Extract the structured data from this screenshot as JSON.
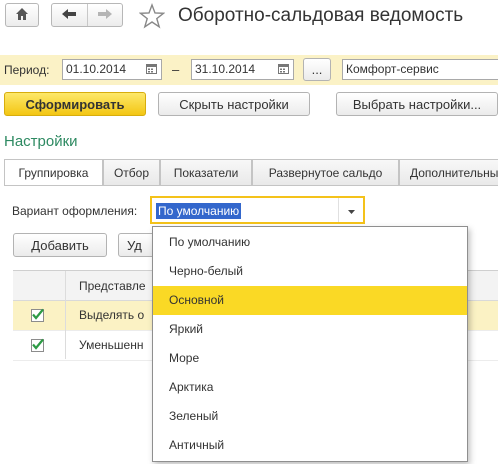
{
  "window": {
    "title": "Оборотно-сальдовая ведомость"
  },
  "toolbar": {
    "home_icon": "home-icon",
    "back_icon": "arrow-left-icon",
    "forward_icon": "arrow-right-icon",
    "favorite_icon": "star-icon"
  },
  "period": {
    "label": "Период:",
    "from": "01.10.2014",
    "separator": "–",
    "to": "31.10.2014",
    "more_label": "...",
    "organization": "Комфорт-сервис"
  },
  "actions": {
    "generate": "Сформировать",
    "hide_settings": "Скрыть настройки",
    "choose_settings": "Выбрать настройки..."
  },
  "settings": {
    "title": "Настройки",
    "tabs": [
      {
        "label": "Группировка"
      },
      {
        "label": "Отбор"
      },
      {
        "label": "Показатели"
      },
      {
        "label": "Развернутое сальдо"
      },
      {
        "label": "Дополнительные"
      }
    ],
    "variant_label": "Вариант оформления:",
    "variant_value": "По умолчанию",
    "add_button": "Добавить",
    "delete_button_partial": "Уд",
    "table": {
      "header": "Представле",
      "rows": [
        {
          "checked": true,
          "text": "Выделять о",
          "selected": true
        },
        {
          "checked": true,
          "text": "Уменьшенн",
          "selected": false
        }
      ]
    }
  },
  "dropdown": {
    "options": [
      {
        "label": "По умолчанию"
      },
      {
        "label": "Черно-белый"
      },
      {
        "label": "Основной",
        "selected": true
      },
      {
        "label": "Яркий"
      },
      {
        "label": "Море"
      },
      {
        "label": "Арктика"
      },
      {
        "label": "Зеленый"
      },
      {
        "label": "Античный"
      }
    ]
  },
  "colors": {
    "accent_yellow": "#f4c21a",
    "period_bar_bg": "#fbf2c6",
    "settings_title": "#2e8a62",
    "selection_blue": "#3367cc",
    "dropdown_selected": "#fad925"
  }
}
